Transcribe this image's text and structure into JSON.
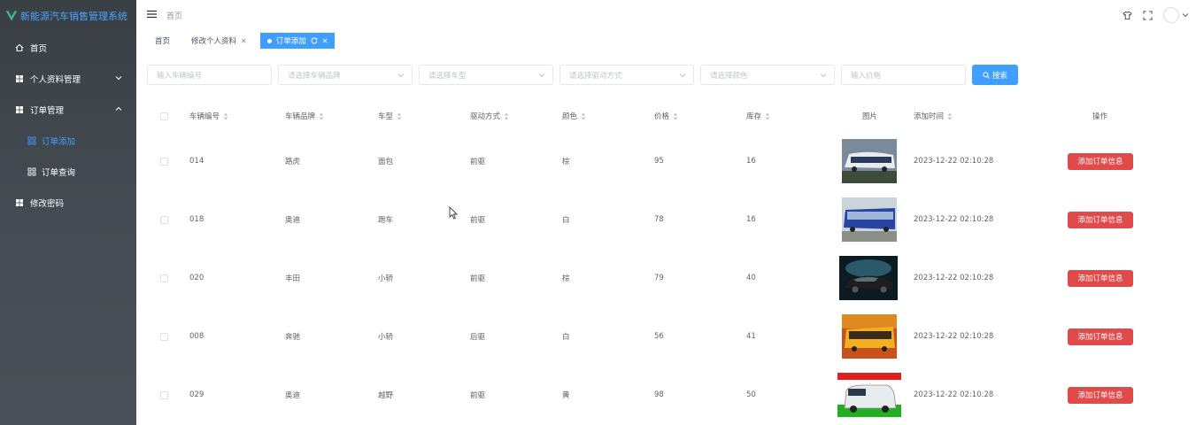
{
  "app": {
    "title": "新能源汽车销售管理系统"
  },
  "sidebar": {
    "items": [
      {
        "label": "首页",
        "icon": "home-icon"
      },
      {
        "label": "个人资料管理",
        "icon": "grid-icon",
        "expanded": false
      },
      {
        "label": "订单管理",
        "icon": "grid-icon",
        "expanded": true
      },
      {
        "label": "订单添加",
        "icon": "apps-icon",
        "sub": true,
        "active": true
      },
      {
        "label": "订单查询",
        "icon": "apps-icon",
        "sub": true
      },
      {
        "label": "修改密码",
        "icon": "grid-icon"
      }
    ]
  },
  "header": {
    "breadcrumb": "首页"
  },
  "tags": [
    {
      "label": "首页"
    },
    {
      "label": "修改个人资料",
      "closable": true
    },
    {
      "label": "订单添加",
      "active": true
    }
  ],
  "filters": {
    "car_no_placeholder": "输入车辆编号",
    "brand_placeholder": "请选择车辆品牌",
    "type_placeholder": "请选择车型",
    "drive_placeholder": "请选择驱动方式",
    "color_placeholder": "请选择颜色",
    "price_placeholder": "输入价格",
    "search_label": "搜索"
  },
  "table": {
    "headers": {
      "car_no": "车辆编号",
      "brand": "车辆品牌",
      "type": "车型",
      "drive": "驱动方式",
      "color": "颜色",
      "price": "价格",
      "stock": "库存",
      "image": "图片",
      "added": "添加时间",
      "action": "操作"
    },
    "action_label": "添加订单信息",
    "rows": [
      {
        "car_no": "014",
        "brand": "路虎",
        "type": "面包",
        "drive": "前驱",
        "color": "棕",
        "price": "95",
        "stock": "16",
        "added": "2023-12-22 02:10:28"
      },
      {
        "car_no": "018",
        "brand": "奥迪",
        "type": "跑车",
        "drive": "前驱",
        "color": "白",
        "price": "78",
        "stock": "16",
        "added": "2023-12-22 02:10:28"
      },
      {
        "car_no": "020",
        "brand": "丰田",
        "type": "小轿",
        "drive": "前驱",
        "color": "棕",
        "price": "79",
        "stock": "40",
        "added": "2023-12-22 02:10:28"
      },
      {
        "car_no": "008",
        "brand": "奔驰",
        "type": "小轿",
        "drive": "后驱",
        "color": "白",
        "price": "56",
        "stock": "41",
        "added": "2023-12-22 02:10:28"
      },
      {
        "car_no": "029",
        "brand": "奥迪",
        "type": "越野",
        "drive": "前驱",
        "color": "黄",
        "price": "98",
        "stock": "50",
        "added": "2023-12-22 02:10:28"
      }
    ]
  },
  "colors": {
    "accent": "#409eff",
    "danger": "#e04a4a",
    "sidebar_bg": "#3f454b"
  }
}
